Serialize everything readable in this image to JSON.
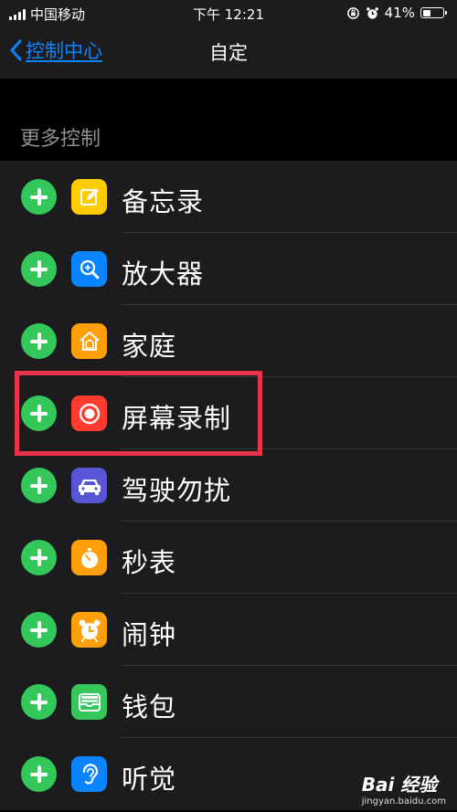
{
  "status_bar": {
    "carrier": "中国移动",
    "time": "下午 12:21",
    "battery_percent": "41%",
    "battery_level": 0.41
  },
  "nav": {
    "back_label": "控制中心",
    "title": "自定"
  },
  "section": {
    "header": "更多控制"
  },
  "controls": [
    {
      "label": "备忘录",
      "icon": "notes-icon",
      "color": "#ffcc00"
    },
    {
      "label": "放大器",
      "icon": "magnifier-icon",
      "color": "#0a84ff"
    },
    {
      "label": "家庭",
      "icon": "home-icon",
      "color": "#ff9f0a"
    },
    {
      "label": "屏幕录制",
      "icon": "screen-record-icon",
      "color": "#ff3b30",
      "highlighted": true
    },
    {
      "label": "驾驶勿扰",
      "icon": "car-icon",
      "color": "#5856d6"
    },
    {
      "label": "秒表",
      "icon": "stopwatch-icon",
      "color": "#ff9f0a"
    },
    {
      "label": "闹钟",
      "icon": "alarm-icon",
      "color": "#ff9f0a"
    },
    {
      "label": "钱包",
      "icon": "wallet-icon",
      "color": "#34c759"
    },
    {
      "label": "听觉",
      "icon": "hearing-icon",
      "color": "#0a84ff"
    }
  ],
  "watermark": {
    "logo": "Bai 经验",
    "url": "jingyan.baidu.com"
  },
  "colors": {
    "accent": "#0a84ff",
    "add_button": "#34c759",
    "highlight_box": "#e8334a"
  }
}
